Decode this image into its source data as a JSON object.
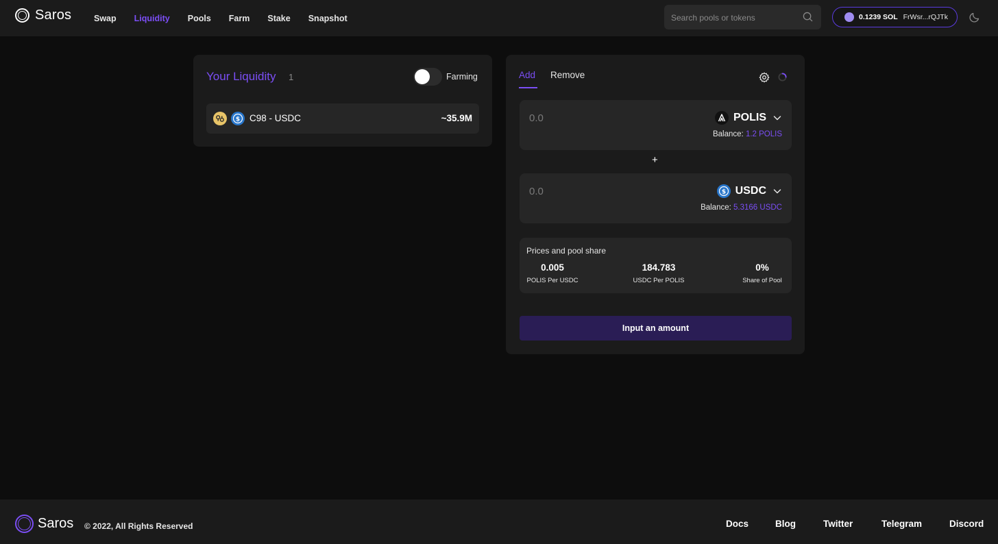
{
  "header": {
    "logo_text": "Saros",
    "nav": [
      "Swap",
      "Liquidity",
      "Pools",
      "Farm",
      "Stake",
      "Snapshot"
    ],
    "active_nav": "Liquidity",
    "search_placeholder": "Search pools or tokens",
    "wallet": {
      "balance": "0.1239 SOL",
      "address": "FrWsr...rQJTk"
    }
  },
  "liquidity": {
    "title": "Your Liquidity",
    "count": "1",
    "toggle_label": "Farming",
    "toggle_on": false,
    "pools": [
      {
        "name": "C98 - USDC",
        "value": "~35.9M"
      }
    ]
  },
  "panel": {
    "tabs": {
      "add": "Add",
      "remove": "Remove"
    },
    "token_a": {
      "placeholder": "0.0",
      "symbol": "POLIS",
      "balance_label": "Balance:",
      "balance_value": "1.2 POLIS"
    },
    "plus": "+",
    "token_b": {
      "placeholder": "0.0",
      "symbol": "USDC",
      "balance_label": "Balance:",
      "balance_value": "5.3166 USDC"
    },
    "prices": {
      "title": "Prices and pool share",
      "items": [
        {
          "value": "0.005",
          "label": "POLIS Per USDC"
        },
        {
          "value": "184.783",
          "label": "USDC Per POLIS"
        },
        {
          "value": "0%",
          "label": "Share of Pool"
        }
      ]
    },
    "action_label": "Input an amount"
  },
  "footer": {
    "logo_text": "Saros",
    "copyright": "© 2022, All Rights Reserved",
    "links": [
      "Docs",
      "Blog",
      "Twitter",
      "Telegram",
      "Discord"
    ]
  },
  "colors": {
    "accent": "#7b4ef5",
    "bg": "#0d0d0d",
    "panel": "#1b1b1b",
    "field": "#262626",
    "button": "#2a1d55"
  }
}
